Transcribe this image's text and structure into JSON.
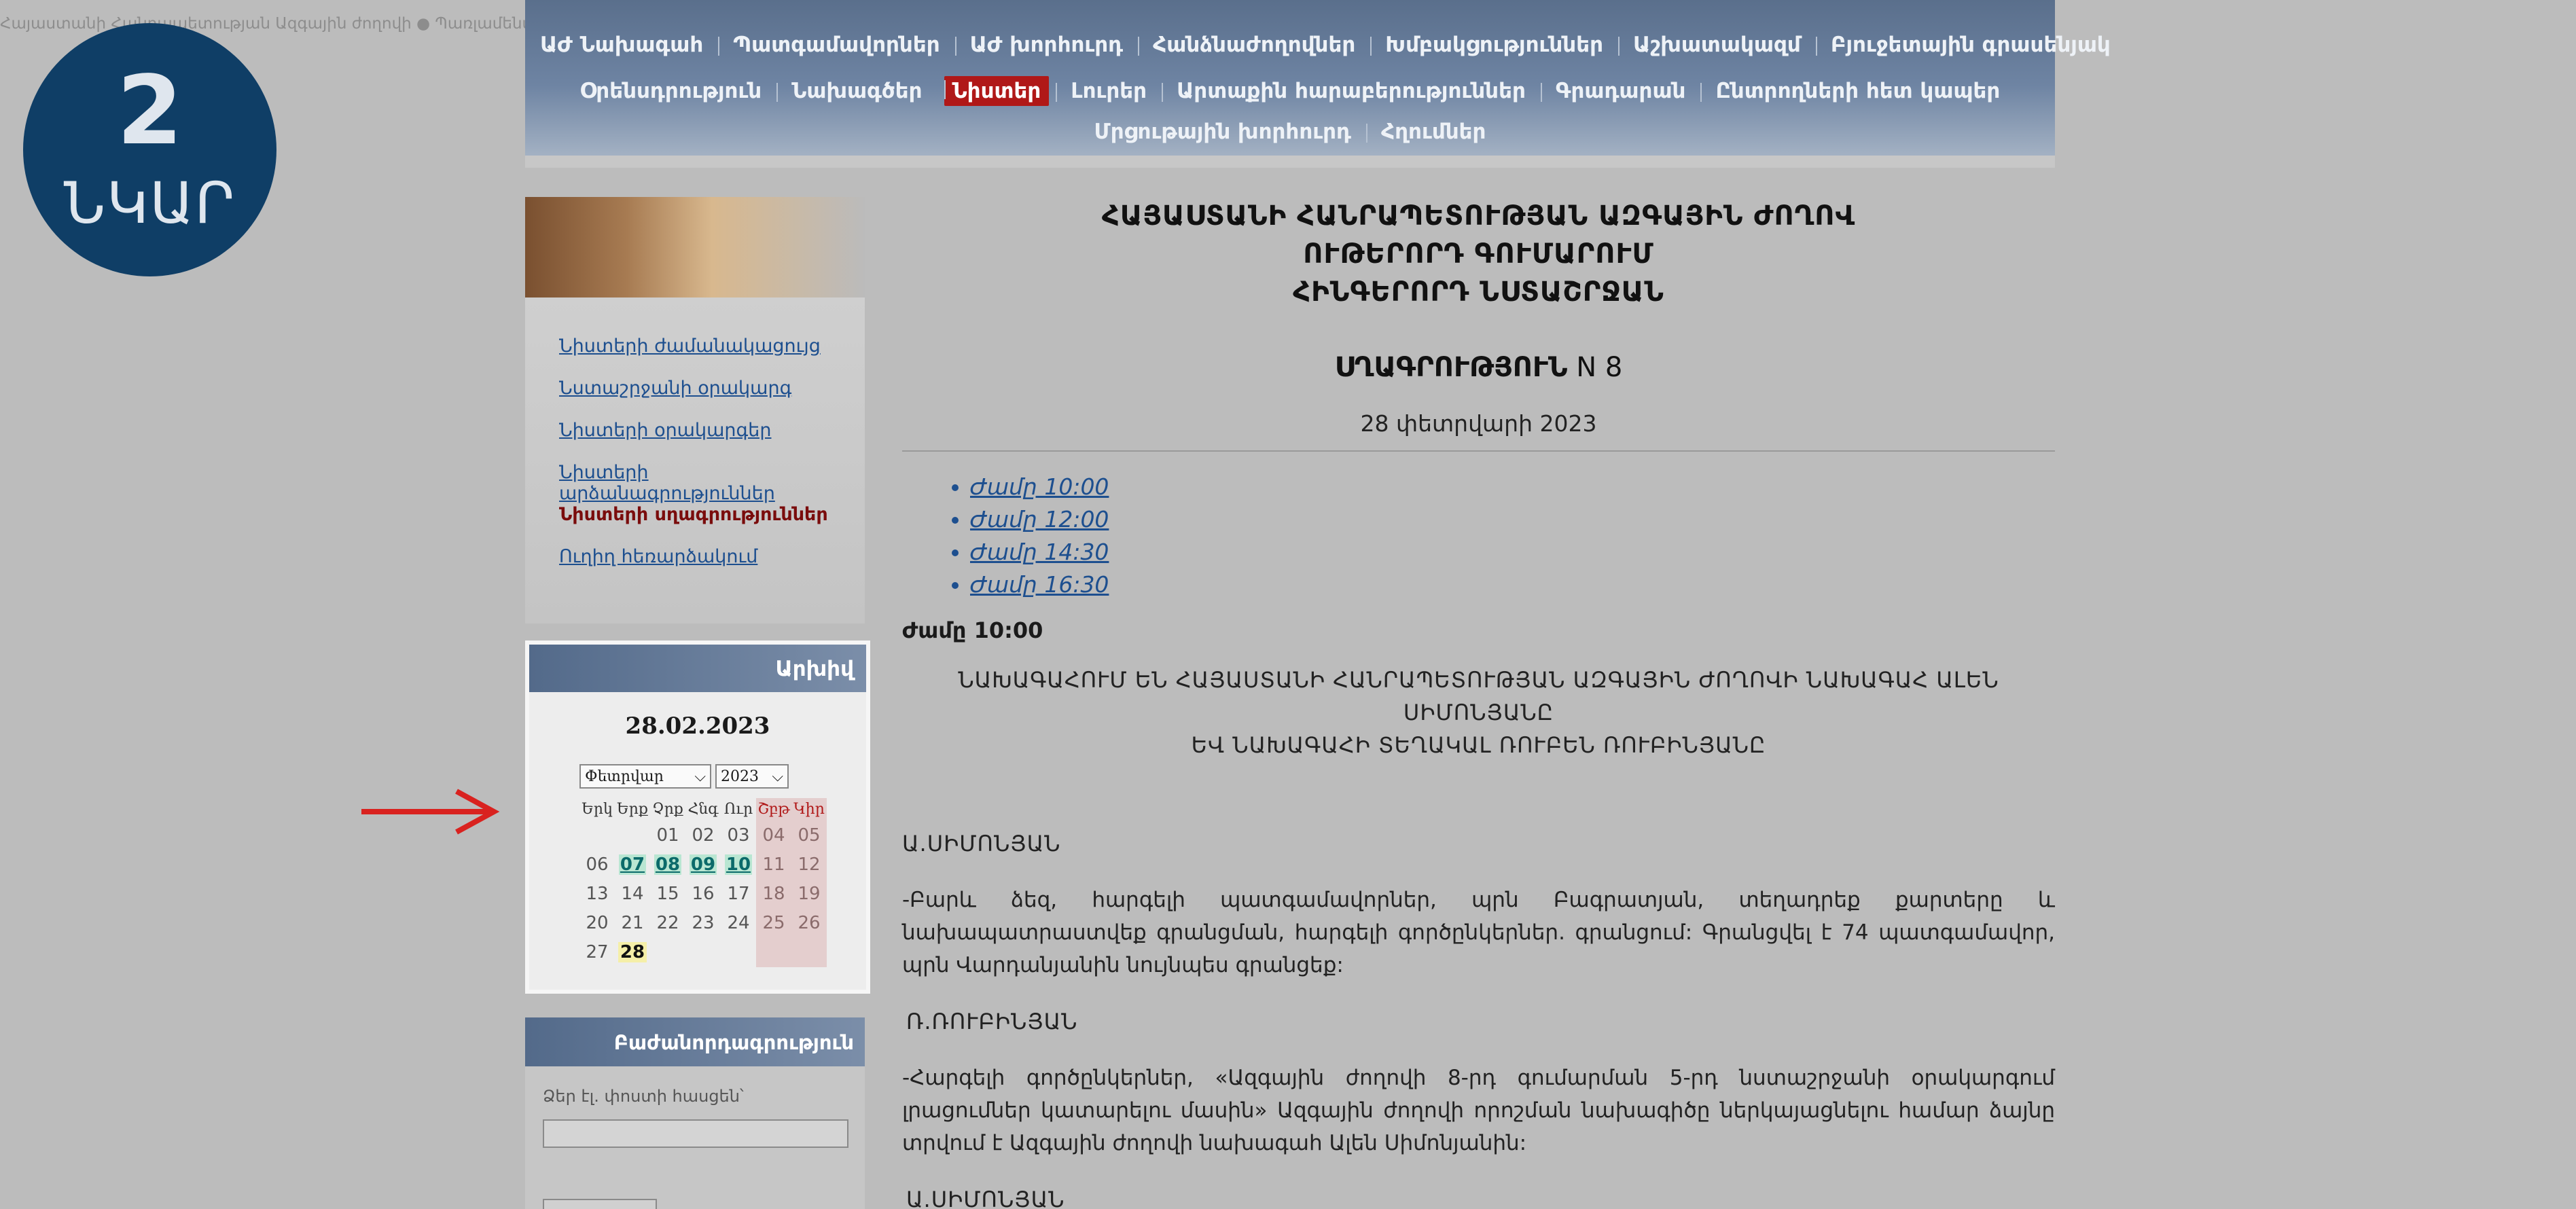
{
  "ticker": "Հայաստանի Հանրապետության Ազգային ժողովի ● Պառլամենտական հանրապետության  ● Հայաստանի Հանրապետության Ազգային ժողովի ● Պառլամենտական հանրապետության Ազգային ժողով ● Հայաստանի Հանրապետության",
  "badge": {
    "number": "2",
    "word": "ՆԿԱՐ"
  },
  "nav": {
    "row1": [
      "ԱԺ Նախագահ",
      "Պատգամավորներ",
      "ԱԺ խորհուրդ",
      "Հանձնաժողովներ",
      "Խմբակցություններ",
      "Աշխատակազմ",
      "Բյուջետային գրասենյակ"
    ],
    "row2": [
      "Օրենսդրություն",
      "Նախագծեր",
      "Նիստեր",
      "Լուրեր",
      "Արտաքին հարաբերություններ",
      "Գրադարան",
      "Ընտրողների հետ կապեր"
    ],
    "row3": [
      "Մրցութային խորհուրդ",
      "Հղումներ"
    ],
    "active": "Նիստեր"
  },
  "sidebar": {
    "links": [
      "Նիստերի ժամանակացույց",
      "Նստաշրջանի օրակարգ",
      "Նիստերի օրակարգեր",
      "Նիստերի արձանագրություններ",
      "Նիստերի սղագրություններ",
      "Ուղիղ հեռարձակում"
    ],
    "current": "Նիստերի սղագրություններ"
  },
  "calendar": {
    "header": "Արխիվ",
    "date": "28.02.2023",
    "month": "Փետրվար",
    "year": "2023",
    "weekdays": [
      "Երկ",
      "Երք",
      "Չրք",
      "Հնգ",
      "Ուր",
      "Շբթ",
      "Կիր"
    ],
    "weeks": [
      [
        "",
        "",
        "01",
        "02",
        "03",
        "04",
        "05"
      ],
      [
        "06",
        "07",
        "08",
        "09",
        "10",
        "11",
        "12"
      ],
      [
        "13",
        "14",
        "15",
        "16",
        "17",
        "18",
        "19"
      ],
      [
        "20",
        "21",
        "22",
        "23",
        "24",
        "25",
        "26"
      ],
      [
        "27",
        "28",
        "",
        "",
        "",
        "",
        ""
      ]
    ],
    "linked_days": [
      "07",
      "08",
      "09",
      "10"
    ],
    "today": "28"
  },
  "subscription": {
    "header": "Բաժանորդագրություն",
    "label": "Ձեր էլ. փոստի հասցեն՝"
  },
  "main": {
    "title_lines": [
      "ՀԱՅԱՍՏԱՆԻ ՀԱՆՐԱՊԵՏՈՒԹՅԱՆ ԱԶԳԱՅԻՆ ԺՈՂՈՎ",
      "ՈՒԹԵՐՈՐԴ ԳՈՒՄԱՐՈՒՄ",
      "ՀԻՆԳԵՐՈՐԴ ՆՍՏԱՇՐՋԱՆ"
    ],
    "doc_title": "ՍՂԱԳՐՈՒԹՅՈՒՆ",
    "doc_number": "N 8",
    "date": "28 փետրվարի 2023",
    "times": [
      "Ժամը 10:00",
      "Ժամը 12:00",
      "Ժամը 14:30",
      "Ժամը 16:30"
    ],
    "section_title": "Ժամը 10:00",
    "presiding_line1": "ՆԱԽԱԳԱՀՈՒՄ ԵՆ ՀԱՅԱՍՏԱՆԻ ՀԱՆՐԱՊԵՏՈՒԹՅԱՆ ԱԶԳԱՅԻՆ ԺՈՂՈՎԻ ՆԱԽԱԳԱՀ ԱԼԵՆ ՍԻՄՈՆՅԱՆԸ",
    "presiding_line2": "ԵՎ ՆԱԽԱԳԱՀԻ ՏԵՂԱԿԱԼ ՌՈՒԲԵՆ ՌՈՒԲԻՆՅԱՆԸ",
    "speaker1": "Ա.ՍԻՄՈՆՅԱՆ",
    "para1": "-Բարև ձեզ, հարգելի պատգամավորներ, պրն Բագրատյան, տեղադրեք քարտերը և նախապատրաստվեք գրանցման, հարգելի գործընկերներ. գրանցում: Գրանցվել է 74 պատգամավոր, պրն Վարդանյանին նույնպես գրանցեք:",
    "speaker2": "Ռ.ՌՈՒԲԻՆՅԱՆ",
    "para2": "-Հարգելի գործընկերներ, «Ազգային ժողովի 8-րդ գումարման 5-րդ նստաշրջանի օրակարգում լրացումներ կատարելու մասին» Ազգային ժողովի որոշման նախագիծը ներկայացնելու համար ձայնը տրվում է Ազգային ժողովի նախագահ Ալեն Սիմոնյանին:",
    "speaker3": "Ա.ՍԻՄՈՆՅԱՆ"
  }
}
